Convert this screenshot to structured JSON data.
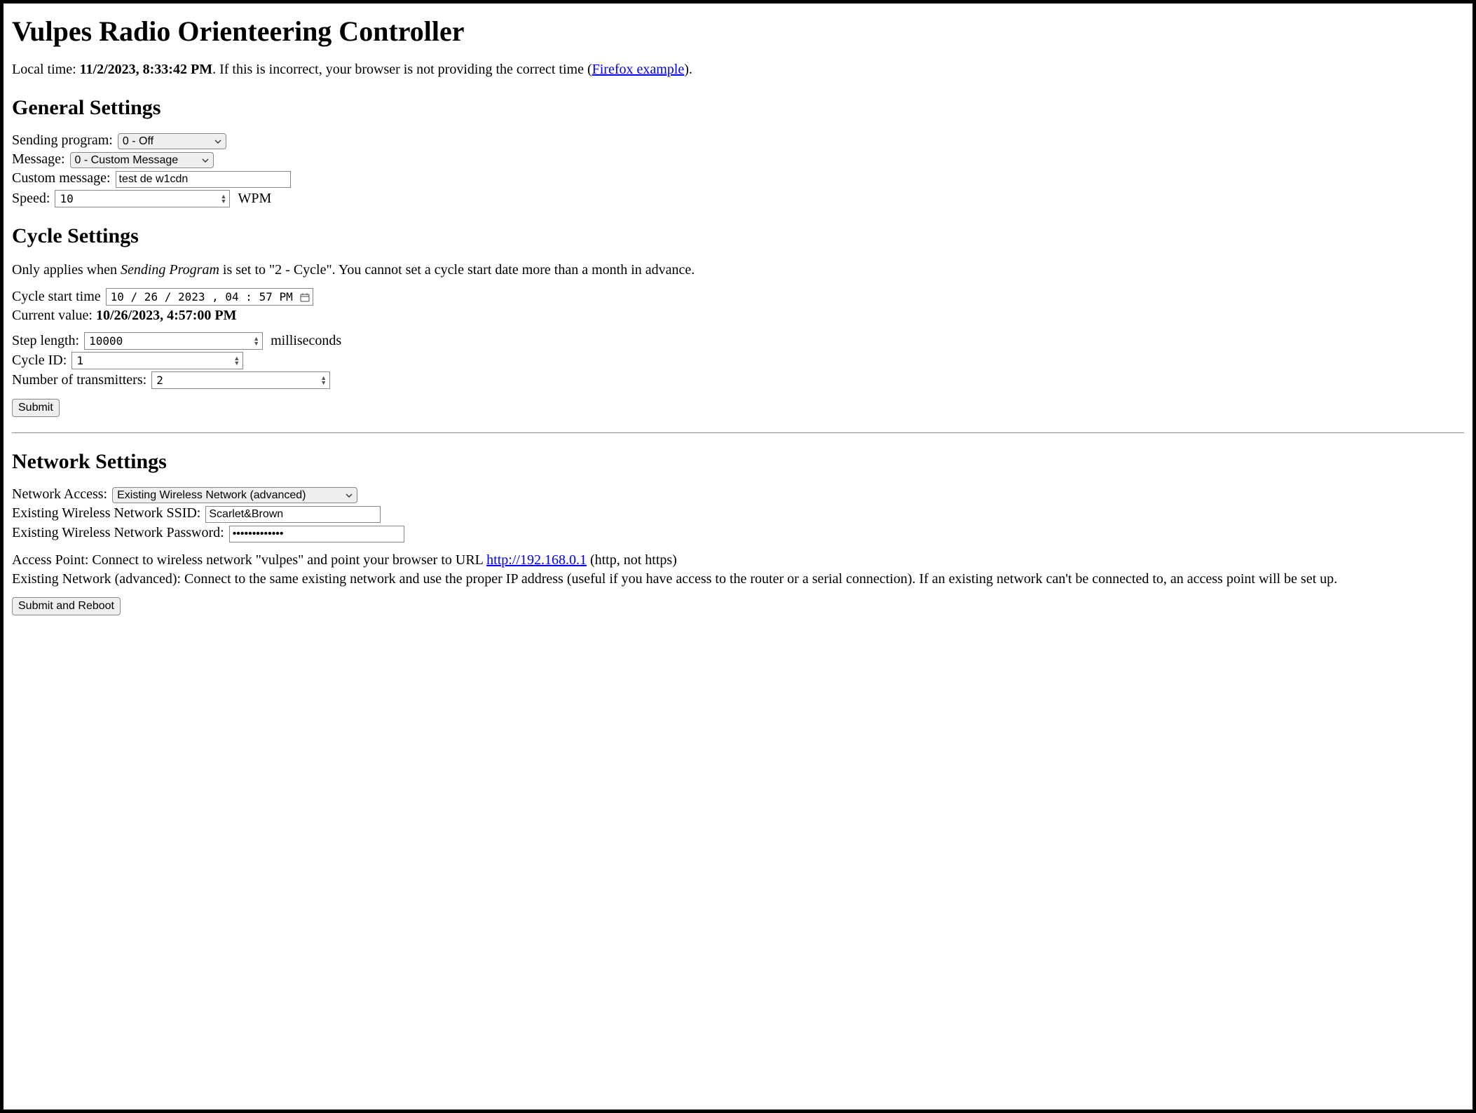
{
  "title": "Vulpes Radio Orienteering Controller",
  "local_time": {
    "label": "Local time: ",
    "value": "11/2/2023, 8:33:42 PM",
    "suffix": ". If this is incorrect, your browser is not providing the correct time (",
    "link_text": "Firefox example",
    "after_link": ")."
  },
  "general": {
    "heading": "General Settings",
    "sending_program": {
      "label": "Sending program:",
      "selected": "0 - Off"
    },
    "message": {
      "label": "Message:",
      "selected": "0 - Custom Message"
    },
    "custom_message": {
      "label": "Custom message:",
      "value": "test de w1cdn"
    },
    "speed": {
      "label": "Speed:",
      "value": "10",
      "unit": "WPM"
    }
  },
  "cycle": {
    "heading": "Cycle Settings",
    "note_pre": "Only applies when ",
    "note_em": "Sending Program",
    "note_post": " is set to \"2 - Cycle\". You cannot set a cycle start date more than a month in advance.",
    "start_time": {
      "label": "Cycle start time",
      "value": "10 / 26 / 2023 ,  04 : 57   PM"
    },
    "current_value": {
      "label": "Current value: ",
      "value": "10/26/2023, 4:57:00 PM"
    },
    "step_length": {
      "label": "Step length:",
      "value": "10000",
      "unit": "milliseconds"
    },
    "cycle_id": {
      "label": "Cycle ID:",
      "value": "1"
    },
    "n_tx": {
      "label": "Number of transmitters:",
      "value": "2"
    },
    "submit_label": "Submit"
  },
  "network": {
    "heading": "Network Settings",
    "access": {
      "label": "Network Access:",
      "selected": "Existing Wireless Network (advanced)"
    },
    "ssid": {
      "label": "Existing Wireless Network SSID:",
      "value": "Scarlet&Brown"
    },
    "password": {
      "label": "Existing Wireless Network Password:",
      "value": "•••••••••••••"
    },
    "help_ap_pre": "Access Point: Connect to wireless network \"vulpes\" and point your browser to URL ",
    "help_ap_link": "http://192.168.0.1",
    "help_ap_post": " (http, not https)",
    "help_existing": "Existing Network (advanced): Connect to the same existing network and use the proper IP address (useful if you have access to the router or a serial connection). If an existing network can't be connected to, an access point will be set up.",
    "submit_label": "Submit and Reboot"
  }
}
